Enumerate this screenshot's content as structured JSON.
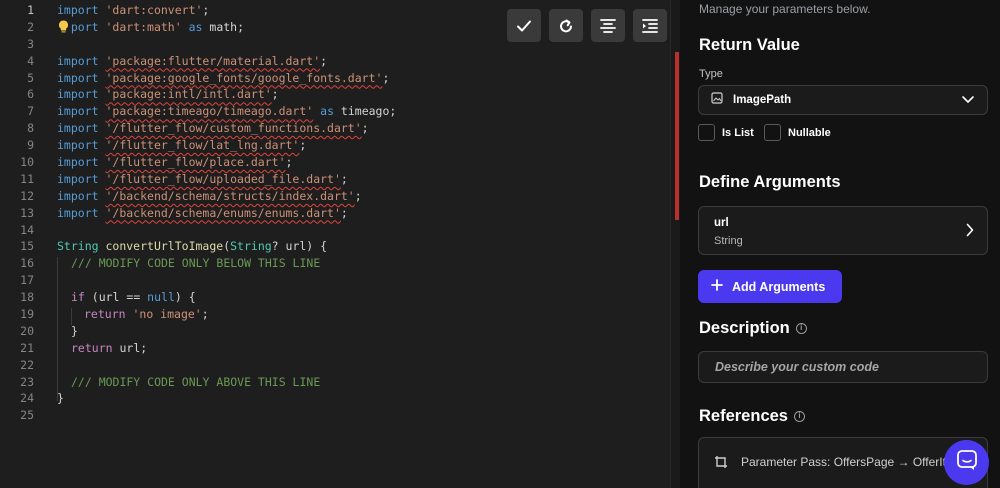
{
  "editor": {
    "line_numbers": [
      "1",
      "2",
      "3",
      "4",
      "5",
      "6",
      "7",
      "8",
      "9",
      "10",
      "11",
      "12",
      "13",
      "14",
      "15",
      "16",
      "17",
      "18",
      "19",
      "20",
      "21",
      "22",
      "23",
      "24",
      "25"
    ],
    "lines": {
      "l1_kw": "import",
      "l1_str": "'dart:convert'",
      "l1_end": ";",
      "l2_kw": "port",
      "l2_str": "'dart:math'",
      "l2_as": "as",
      "l2_end": " math;",
      "l4_kw": "import",
      "l4_str": "'package:flutter/material.dart'",
      "l4_end": ";",
      "l5_kw": "import",
      "l5_str": "'package:google_fonts/google_fonts.dart'",
      "l5_end": ";",
      "l6_kw": "import",
      "l6_str": "'package:intl/intl.dart'",
      "l6_end": ";",
      "l7_kw": "import",
      "l7_str": "'package:timeago/timeago.dart'",
      "l7_as": "as",
      "l7_end": " timeago;",
      "l8_kw": "import",
      "l8_str": "'/flutter_flow/custom_functions.dart'",
      "l8_end": ";",
      "l9_kw": "import",
      "l9_str": "'/flutter_flow/lat_lng.dart'",
      "l9_end": ";",
      "l10_kw": "import",
      "l10_str": "'/flutter_flow/place.dart'",
      "l10_end": ";",
      "l11_kw": "import",
      "l11_str": "'/flutter_flow/uploaded_file.dart'",
      "l11_end": ";",
      "l12_kw": "import",
      "l12_str": "'/backend/schema/structs/index.dart'",
      "l12_end": ";",
      "l13_kw": "import",
      "l13_str": "'/backend/schema/enums/enums.dart'",
      "l13_end": ";",
      "l15_type": "String",
      "l15_fn": "convertUrlToImage",
      "l15_p1": "(",
      "l15_ptype": "String",
      "l15_rest": "? url) {",
      "l16_cm": "/// MODIFY CODE ONLY BELOW THIS LINE",
      "l18_if": "if",
      "l18_a": " (url == ",
      "l18_null": "null",
      "l18_b": ") {",
      "l19_ret": "return",
      "l19_str": "'no image'",
      "l19_end": ";",
      "l20": "}",
      "l21_ret": "return",
      "l21_end": " url;",
      "l23_cm": "/// MODIFY CODE ONLY ABOVE THIS LINE",
      "l24": "}"
    },
    "toolbar": [
      "check-icon",
      "refresh-icon",
      "format-align-icon",
      "indent-icon"
    ]
  },
  "panel": {
    "hint": "Manage your parameters below.",
    "return_value": {
      "heading": "Return Value",
      "type_label": "Type",
      "type_value": "ImagePath",
      "is_list_label": "Is List",
      "nullable_label": "Nullable"
    },
    "arguments": {
      "heading": "Define Arguments",
      "items": [
        {
          "name": "url",
          "type": "String"
        }
      ],
      "add_label": "Add Arguments"
    },
    "description": {
      "heading": "Description",
      "placeholder": "Describe your custom code"
    },
    "references": {
      "heading": "References",
      "items": [
        {
          "text": "Parameter Pass: OffersPage → OfferIt"
        }
      ]
    }
  },
  "colors": {
    "accent": "#4b39ef",
    "error_bar": "#b7322c"
  }
}
